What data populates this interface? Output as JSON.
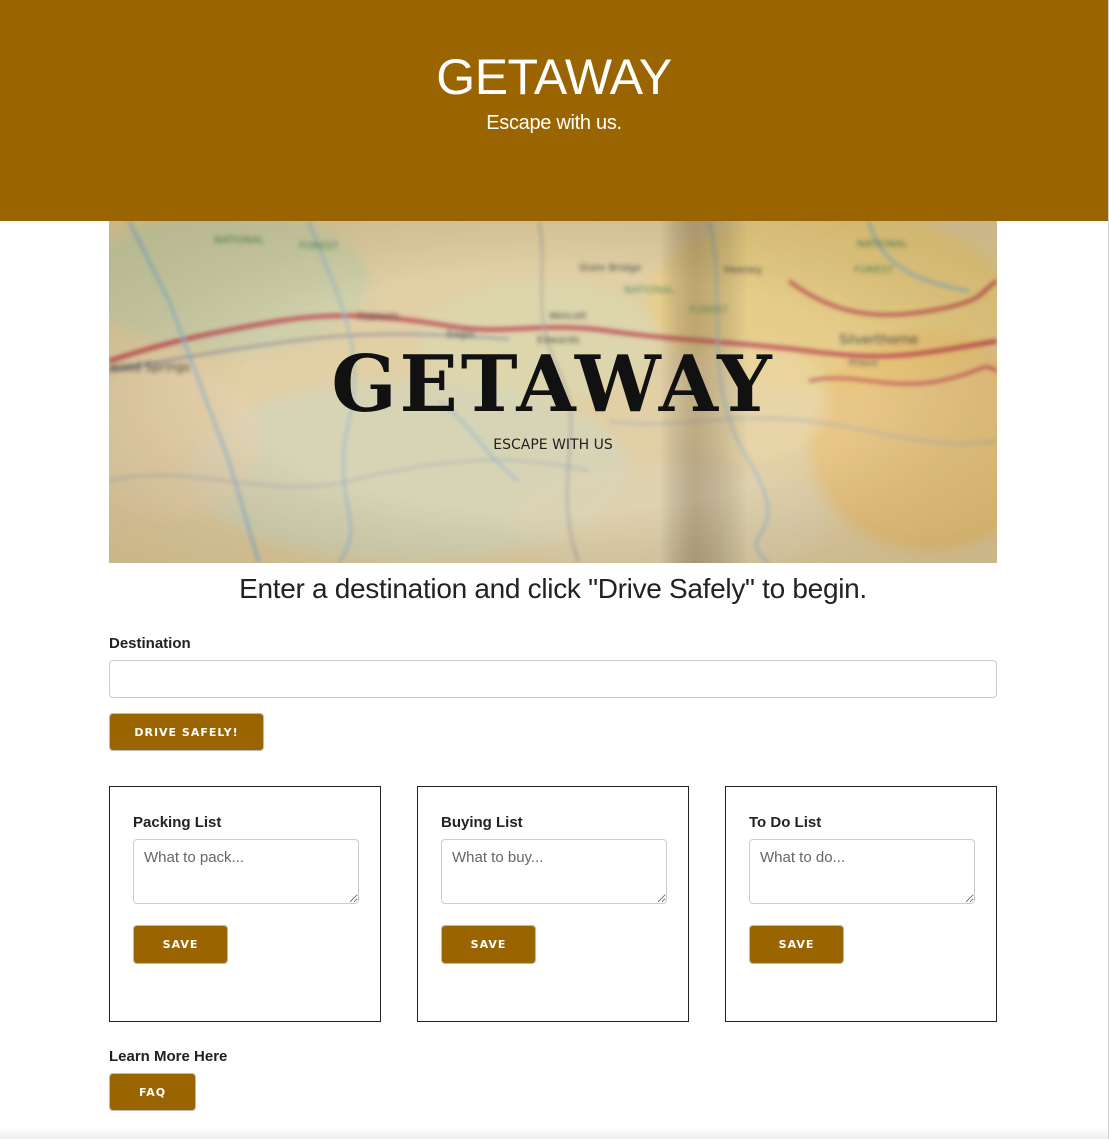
{
  "header": {
    "title": "GETAWAY",
    "tagline": "Escape with us."
  },
  "hero": {
    "title": "GETAWAY",
    "subtitle": "ESCAPE WITH US",
    "map_labels": [
      "NATIONAL",
      "FOREST",
      "Gypsum",
      "Eagle",
      "Edwards",
      "Wolcott",
      "Silverthorne",
      "Frisco",
      "wood Springs",
      "NATIONAL",
      "FOREST",
      "State Bridge",
      "Heeney",
      "NATIONAL"
    ]
  },
  "main": {
    "instructions": "Enter a destination and click \"Drive Safely\" to begin.",
    "destination": {
      "label": "Destination",
      "value": "",
      "placeholder": ""
    },
    "drive_button_label": "DRIVE SAFELY!"
  },
  "lists": [
    {
      "title": "Packing List",
      "placeholder": "What to pack...",
      "value": "",
      "save_label": "SAVE"
    },
    {
      "title": "Buying List",
      "placeholder": "What to buy...",
      "value": "",
      "save_label": "SAVE"
    },
    {
      "title": "To Do List",
      "placeholder": "What to do...",
      "value": "",
      "save_label": "SAVE"
    }
  ],
  "footer": {
    "learn_more_label": "Learn More Here",
    "faq_label": "FAQ"
  },
  "colors": {
    "brand": "#9a6500",
    "text": "#222222",
    "border": "#222222"
  }
}
